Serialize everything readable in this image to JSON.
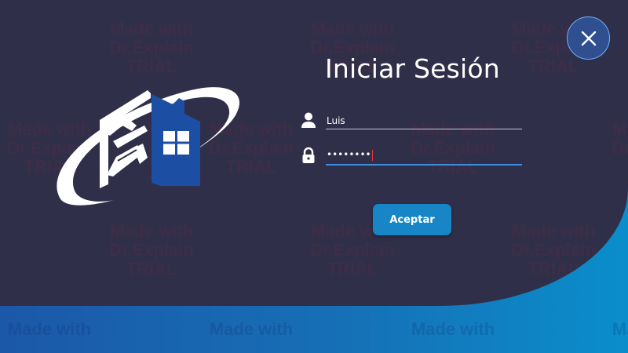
{
  "login": {
    "title": "Iniciar Sesión",
    "username": {
      "value": "Luis",
      "icon": "user-icon"
    },
    "password": {
      "value": "••••••••",
      "icon": "lock-icon"
    },
    "accept_label": "Aceptar"
  },
  "close_button": {
    "icon": "close-icon"
  },
  "watermark": {
    "line1": "Made with",
    "line2": "Dr.Explain",
    "line3": "TRIAL",
    "text": "Made with\nDr.Explain\nTRIAL"
  },
  "logo": {
    "icon": "house-tools-logo"
  },
  "colors": {
    "panel": "#302f49",
    "accent": "#1785c6",
    "background_blue": "#1670b6",
    "input_focus": "#3a8fe0"
  }
}
